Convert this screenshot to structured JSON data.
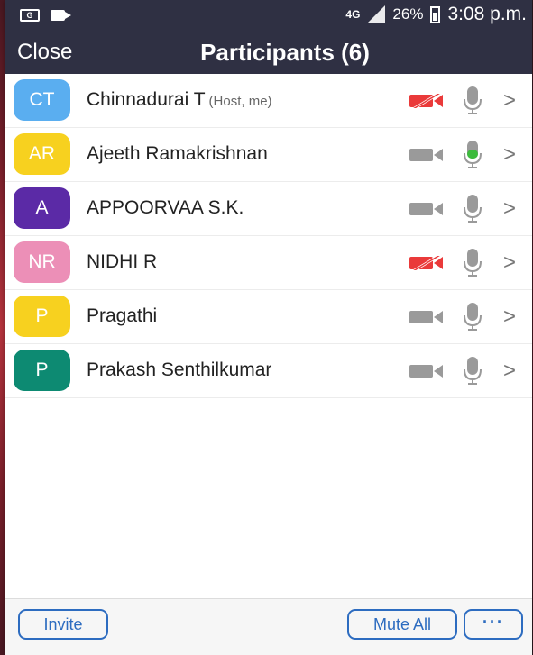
{
  "status_bar": {
    "network": "4G",
    "battery": "26%",
    "time": "3:08 p.m."
  },
  "header": {
    "close_label": "Close",
    "title": "Participants (6)"
  },
  "participants": [
    {
      "initials": "CT",
      "name": "Chinnadurai T",
      "tag": "(Host, me)",
      "avatar_color": "#5aaef0",
      "video_off": true,
      "mic_active": false
    },
    {
      "initials": "AR",
      "name": "Ajeeth Ramakrishnan",
      "tag": "",
      "avatar_color": "#f7d11f",
      "video_off": false,
      "mic_active": true
    },
    {
      "initials": "A",
      "name": "APPOORVAA S.K.",
      "tag": "",
      "avatar_color": "#5b2aa6",
      "video_off": false,
      "mic_active": false
    },
    {
      "initials": "NR",
      "name": "NIDHI R",
      "tag": "",
      "avatar_color": "#ec8fb7",
      "video_off": true,
      "mic_active": false
    },
    {
      "initials": "P",
      "name": "Pragathi",
      "tag": "",
      "avatar_color": "#f7d11f",
      "video_off": false,
      "mic_active": false
    },
    {
      "initials": "P",
      "name": "Prakash Senthilkumar",
      "tag": "",
      "avatar_color": "#0d8a72",
      "video_off": false,
      "mic_active": false
    }
  ],
  "footer": {
    "invite_label": "Invite",
    "mute_all_label": "Mute All",
    "more_label": "···"
  },
  "colors": {
    "bar_bg": "#2f3043",
    "accent": "#2d6cc0",
    "video_off": "#ea3a3a",
    "mic_active": "#3dbb3d",
    "icon_gray": "#9a9a9a"
  },
  "icons": [
    "camera-icon",
    "camera-off-icon",
    "microphone-icon",
    "chevron-right-icon"
  ]
}
